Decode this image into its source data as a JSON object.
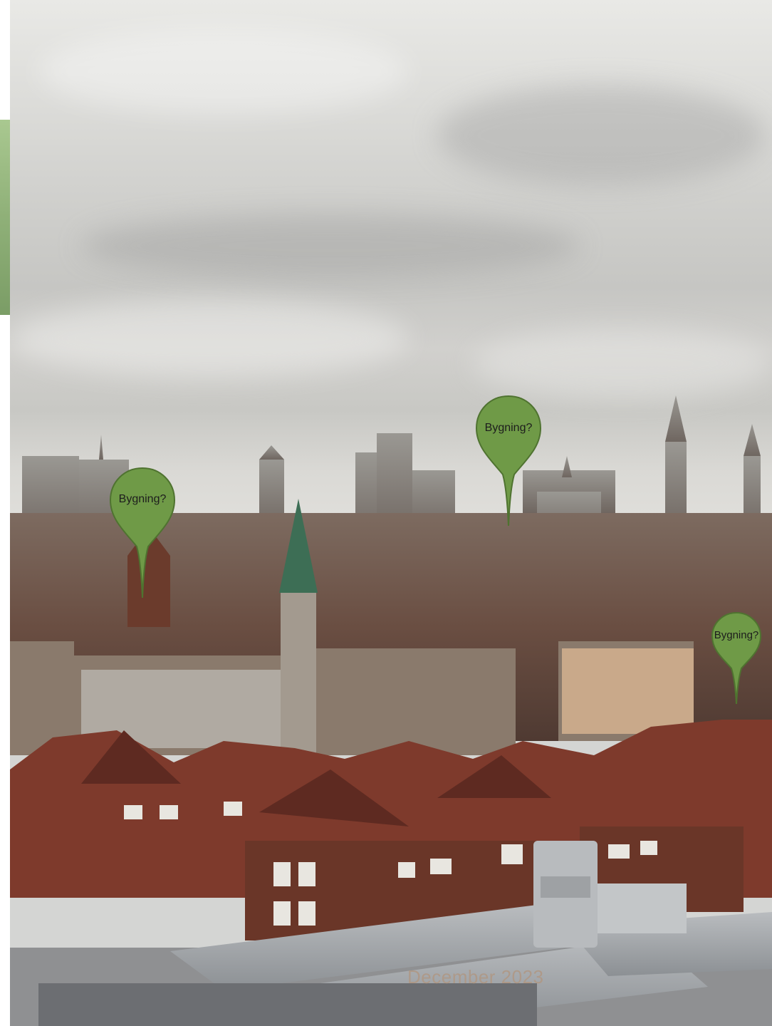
{
  "document": {
    "footer_date": "December 2023",
    "accent_color": "#6f9a47",
    "tab_color": "#8fb078"
  },
  "pins": [
    {
      "label": "Bygning?",
      "icon": "map-pin-icon"
    },
    {
      "label": "Bygning?",
      "icon": "map-pin-icon"
    },
    {
      "label": "Bygning?",
      "icon": "map-pin-icon"
    }
  ]
}
